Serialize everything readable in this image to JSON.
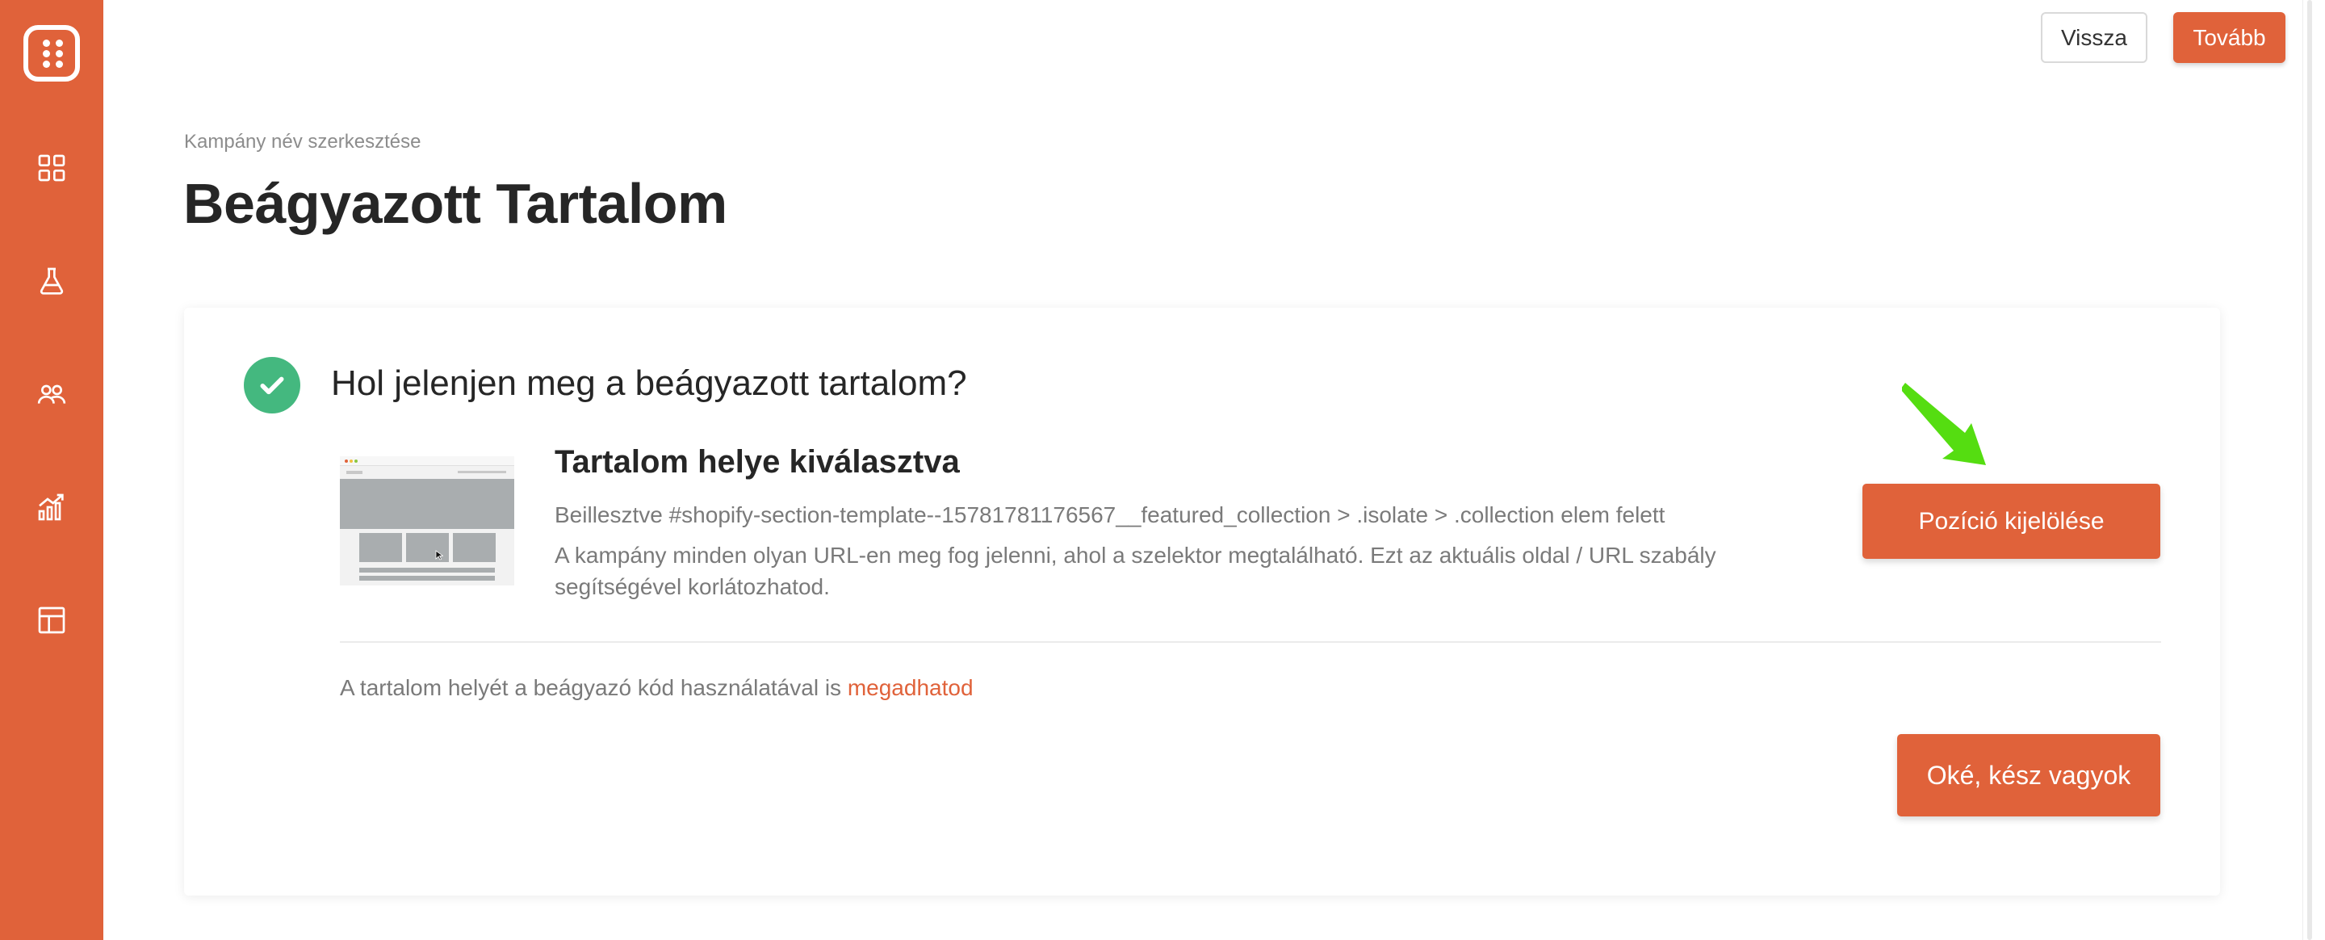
{
  "colors": {
    "brand": "#e0623a",
    "success": "#44b87f",
    "arrow": "#55dd11"
  },
  "sidebar": {
    "logo_icon": "dots-grid-logo",
    "items": [
      {
        "icon": "dashboard-icon"
      },
      {
        "icon": "flask-icon"
      },
      {
        "icon": "users-icon"
      },
      {
        "icon": "analytics-icon"
      },
      {
        "icon": "layout-icon"
      }
    ]
  },
  "toolbar": {
    "back_label": "Vissza",
    "next_label": "Tovább"
  },
  "header": {
    "subtitle": "Kampány név szerkesztése",
    "title": "Beágyazott Tartalom"
  },
  "card": {
    "question": "Hol jelenjen meg a beágyazott tartalom?",
    "selected_title": "Tartalom helye kiválasztva",
    "selected_selector": "Beillesztve #shopify-section-template--15781781176567__featured_collection > .isolate > .collection elem felett",
    "selected_note": "A kampány minden olyan URL-en meg fog jelenni, ahol a szelektor megtalálható. Ezt az aktuális oldal / URL szabály segítségével korlátozhatod.",
    "position_button": "Pozíció kijelölése",
    "embed_text": "A tartalom helyét a beágyazó kód használatával is ",
    "embed_link": "megadhatod",
    "ok_button": "Oké, kész vagyok"
  }
}
